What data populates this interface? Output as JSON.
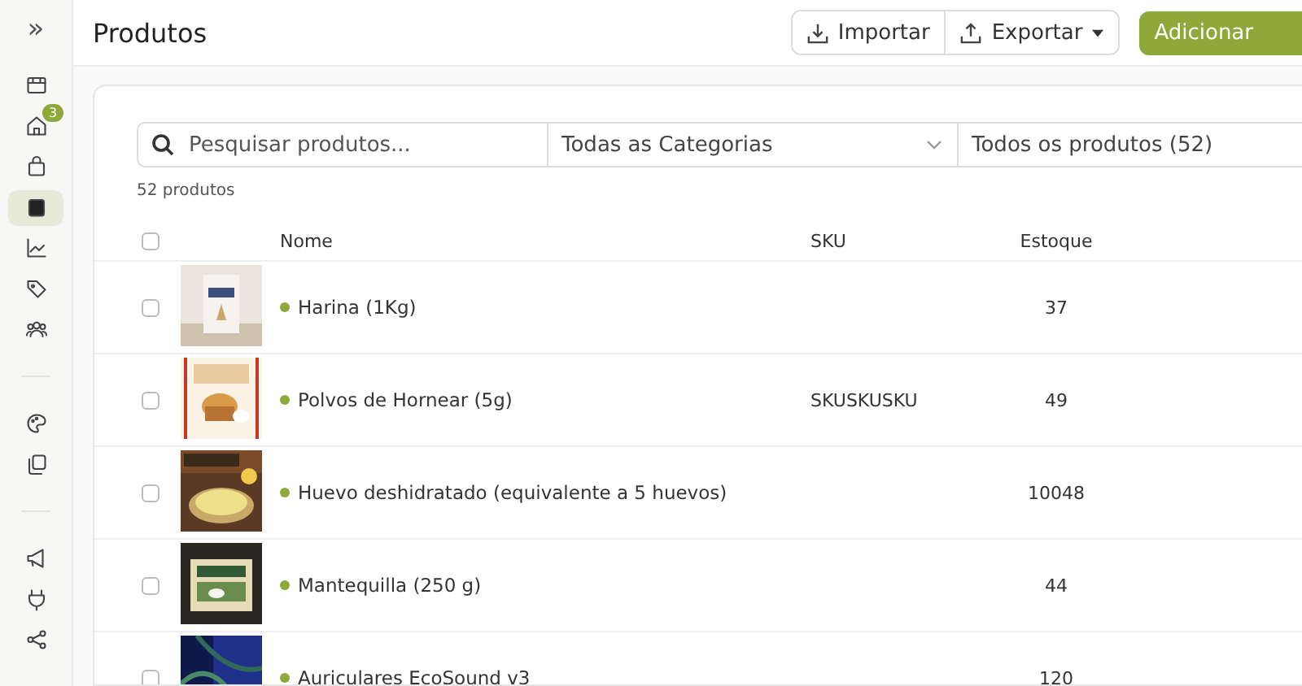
{
  "sidebar": {
    "expand_icon": "»",
    "items": [
      {
        "kind": "store",
        "selected": false
      },
      {
        "kind": "home",
        "selected": false,
        "badge": "3"
      },
      {
        "kind": "bag",
        "selected": false
      },
      {
        "kind": "box",
        "selected": true
      },
      {
        "kind": "chart",
        "selected": false
      },
      {
        "kind": "tag",
        "selected": false
      },
      {
        "kind": "people",
        "selected": false
      },
      {
        "kind": "divider"
      },
      {
        "kind": "palette",
        "selected": false
      },
      {
        "kind": "copy",
        "selected": false
      },
      {
        "kind": "divider"
      },
      {
        "kind": "megaphone",
        "selected": false
      },
      {
        "kind": "plug",
        "selected": false
      },
      {
        "kind": "share",
        "selected": false
      }
    ]
  },
  "header": {
    "title": "Produtos",
    "import_button": "Importar",
    "export_button": "Exportar",
    "add_button": "Adicionar"
  },
  "filters": {
    "search": {
      "placeholder": "Pesquisar produtos..."
    },
    "category": "Todas as Categorias",
    "status": "Todos os produtos (52)"
  },
  "count": "52 produtos",
  "table": {
    "select_all": {
      "checked": false
    },
    "columns": [
      "Nome",
      "SKU",
      "Estoque"
    ],
    "rows": [
      {
        "checked": false,
        "color": "#8fa83a",
        "name": "Harina (1Kg)",
        "sku": "",
        "stock": "37"
      },
      {
        "checked": false,
        "color": "#8fa83a",
        "name": "Polvos de Hornear (5g)",
        "sku": "SKUSKUSKU",
        "stock": "49"
      },
      {
        "checked": false,
        "color": "#8fa83a",
        "name": "Huevo deshidratado (equivalente a 5 huevos)",
        "sku": "",
        "stock": "10048"
      },
      {
        "checked": false,
        "color": "#8fa83a",
        "name": "Mantequilla (250 g)",
        "sku": "",
        "stock": "44"
      },
      {
        "checked": false,
        "color": "#8fa83a",
        "name": "Auriculares EcoSound v3",
        "sku": "",
        "stock": "120"
      }
    ]
  }
}
